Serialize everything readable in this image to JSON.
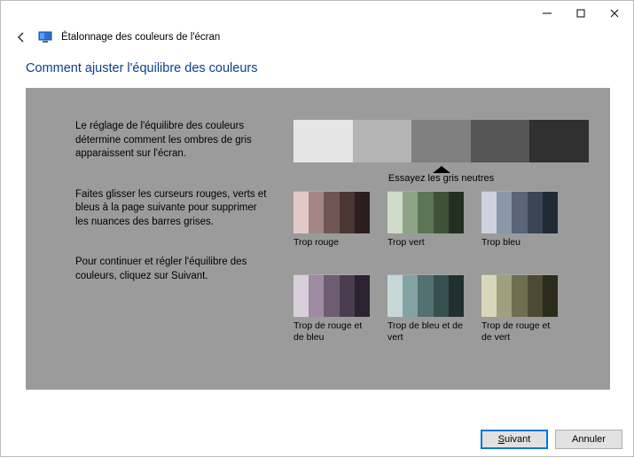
{
  "window": {
    "title": "Étalonnage des couleurs de l'écran"
  },
  "page": {
    "title": "Comment ajuster l'équilibre des couleurs",
    "paragraphs": {
      "p1": "Le réglage de l'équilibre des couleurs détermine comment les ombres de gris apparaissent sur l'écran.",
      "p2": "Faites glisser les curseurs rouges, verts et bleus à la page suivante pour supprimer les nuances des barres grises.",
      "p3": "Pour continuer et régler l'équilibre des couleurs, cliquez sur Suivant."
    },
    "pointer_label": "Essayez les gris neutres",
    "gray_strip": [
      "#e5e5e5",
      "#b4b4b4",
      "#808080",
      "#555555",
      "#303030"
    ],
    "examples": [
      {
        "label": "Trop rouge",
        "colors": [
          "#e1c9c9",
          "#a58686",
          "#705555",
          "#4b3636",
          "#2c1e1e"
        ]
      },
      {
        "label": "Trop vert",
        "colors": [
          "#cfdbc8",
          "#8ea486",
          "#5e7556",
          "#3e5239",
          "#233021"
        ]
      },
      {
        "label": "Trop bleu",
        "colors": [
          "#cdd3de",
          "#8b97aa",
          "#5a657a",
          "#3b4556",
          "#222a36"
        ]
      },
      {
        "label": "Trop de rouge et de bleu",
        "colors": [
          "#d9cfdb",
          "#9f8ba3",
          "#6e5c73",
          "#4a3d50",
          "#2b2430"
        ]
      },
      {
        "label": "Trop de bleu et de vert",
        "colors": [
          "#c7d7d8",
          "#83a2a3",
          "#547172",
          "#384f50",
          "#203031"
        ]
      },
      {
        "label": "Trop de rouge et de vert",
        "colors": [
          "#d8d7bb",
          "#a1a07c",
          "#6f6e4f",
          "#4b4b34",
          "#2c2c1d"
        ]
      }
    ]
  },
  "buttons": {
    "next_prefix": "S",
    "next_rest": "uivant",
    "cancel": "Annuler"
  }
}
